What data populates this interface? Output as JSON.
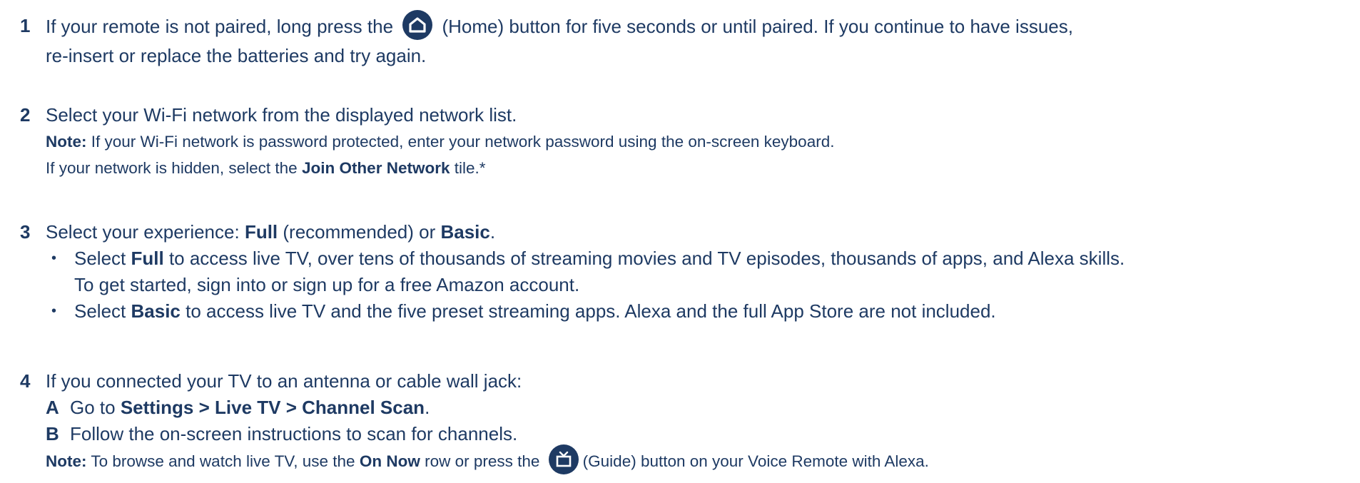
{
  "steps": [
    {
      "number": "1",
      "line1_pre": "If your remote is not paired, long press the",
      "line1_post": "(Home) button for five seconds or until paired. If you continue to have issues,",
      "line2": "re-insert or replace the batteries and try again.",
      "icon": "home-icon"
    },
    {
      "number": "2",
      "line1": "Select your Wi-Fi network from the displayed network list.",
      "note_label": "Note:",
      "note_text": " If your Wi-Fi network is password protected, enter your network password using the on-screen keyboard.",
      "hidden_pre": "If your network is hidden, select the ",
      "hidden_bold": "Join Other Network",
      "hidden_post": " tile.*"
    },
    {
      "number": "3",
      "line1_pre": "Select your experience: ",
      "full": "Full",
      "line1_mid": " (recommended) or ",
      "basic": "Basic",
      "line1_end": ".",
      "bullet_char": "•",
      "b1_pre": "Select ",
      "b1_bold": "Full",
      "b1_post": " to access live TV, over tens of thousands of streaming movies and TV episodes, thousands of apps, and Alexa skills.",
      "b1_cont": "To get started, sign into or sign up for a free Amazon account.",
      "b2_pre": "Select ",
      "b2_bold": "Basic",
      "b2_post": " to access live TV and the five preset streaming apps. Alexa and the full App Store are not included."
    },
    {
      "number": "4",
      "line1": "If you connected your TV to an antenna or cable wall jack:",
      "a_letter": "A",
      "a_pre": "Go to ",
      "a_bold": "Settings > Live TV > Channel Scan",
      "a_post": ".",
      "b_letter": "B",
      "b_text": "Follow the on-screen instructions to scan for channels.",
      "note_label": "Note:",
      "note_pre": " To browse and watch live TV, use the ",
      "note_bold": "On Now",
      "note_mid": " row or press the",
      "note_post": "(Guide) button on your Voice Remote with Alexa.",
      "icon": "guide-tv-icon"
    }
  ],
  "colors": {
    "text": "#1e3a63",
    "icon_bg": "#1e3a63",
    "icon_fg": "#ffffff"
  }
}
